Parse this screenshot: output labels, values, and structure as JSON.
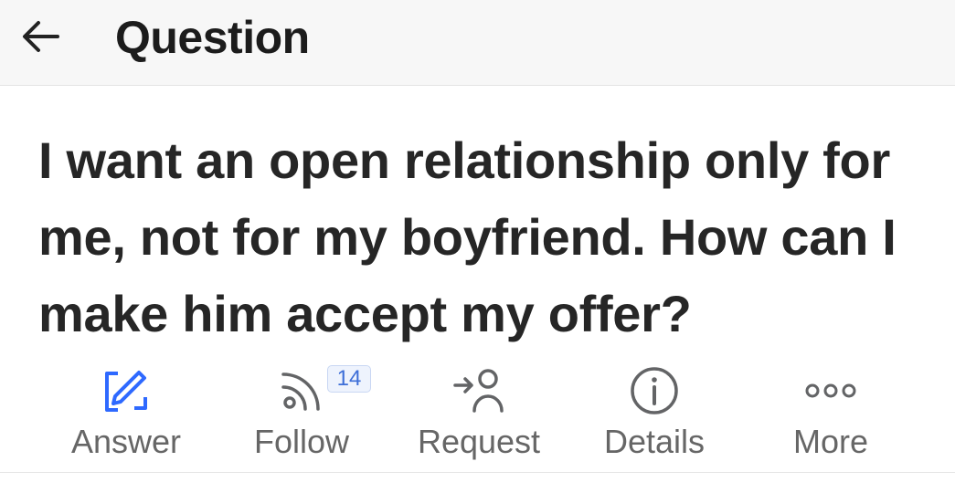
{
  "header": {
    "title": "Question",
    "back_icon": "arrow-left-icon"
  },
  "question": {
    "text": "I want an open relationship only for me, not for my boyfriend. How can I make him accept my offer?"
  },
  "actions": [
    {
      "label": "Answer",
      "icon": "edit-icon",
      "color": "#2e69ff"
    },
    {
      "label": "Follow",
      "icon": "rss-icon",
      "badge": "14"
    },
    {
      "label": "Request",
      "icon": "add-person-icon"
    },
    {
      "label": "Details",
      "icon": "info-icon"
    },
    {
      "label": "More",
      "icon": "more-dots-icon"
    }
  ],
  "colors": {
    "accent": "#2e69ff",
    "icon_gray": "#636466",
    "badge_text": "#3e6fd8"
  }
}
